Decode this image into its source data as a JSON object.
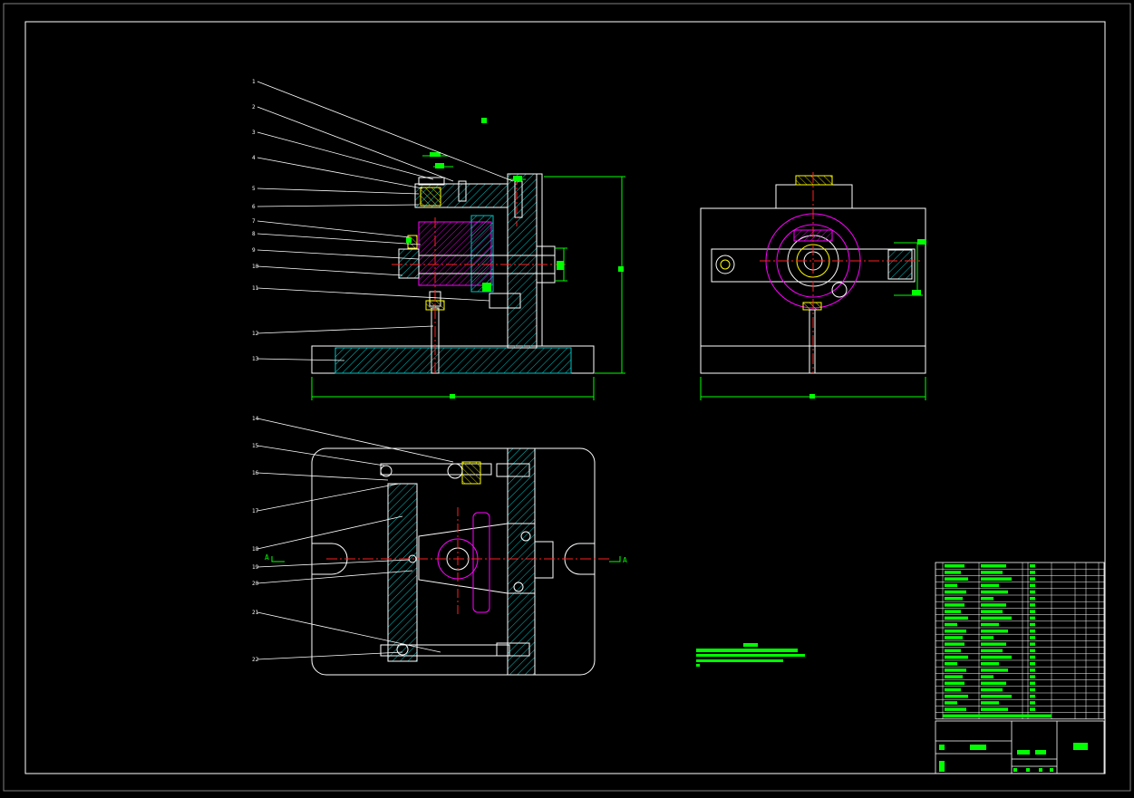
{
  "colors": {
    "background": "#000000",
    "outline": "#ffffff",
    "hatch_cyan": "#00c0c0",
    "hatch_yellow": "#c8c800",
    "dimension": "#00ff00",
    "centerline": "#ff2020",
    "magenta": "#ff00ff",
    "table_fill": "#00ff00"
  },
  "callouts_front": [
    "1",
    "2",
    "3",
    "4",
    "5",
    "6",
    "7",
    "8",
    "9",
    "10",
    "11",
    "12",
    "13"
  ],
  "callouts_top": [
    "14",
    "15",
    "16",
    "17",
    "18",
    "19",
    "20",
    "21",
    "22"
  ],
  "section_marks": {
    "left": "A",
    "right": "A"
  }
}
